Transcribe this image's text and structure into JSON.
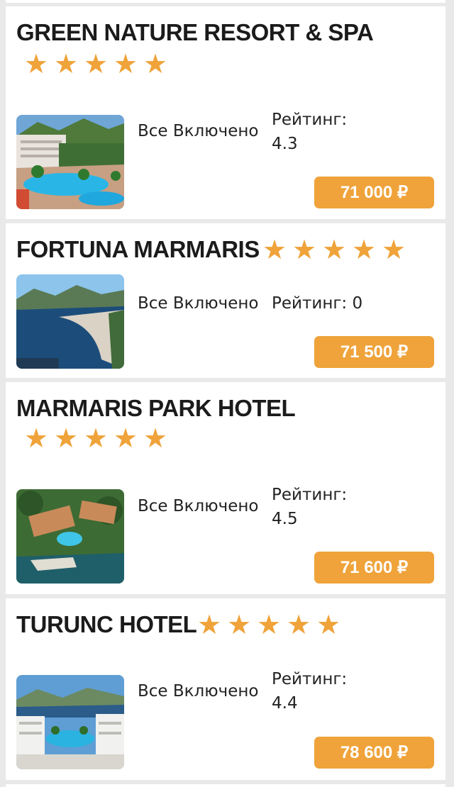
{
  "hotels": [
    {
      "name": "GREEN NATURE RESORT & SPA",
      "stars": 5,
      "board": "Все Включено",
      "rating_label": "Рейтинг:",
      "rating_value": "4.3",
      "price": "71 000 ₽"
    },
    {
      "name": "FORTUNA MARMARIS",
      "stars": 5,
      "board": "Все Включено",
      "rating_label": "Рейтинг: 0",
      "rating_value": "",
      "price": "71 500 ₽"
    },
    {
      "name": "MARMARIS PARK HOTEL",
      "stars": 5,
      "board": "Все Включено",
      "rating_label": "Рейтинг:",
      "rating_value": "4.5",
      "price": "71 600 ₽"
    },
    {
      "name": "TURUNC HOTEL",
      "stars": 5,
      "board": "Все Включено",
      "rating_label": "Рейтинг:",
      "rating_value": "4.4",
      "price": "78 600 ₽"
    }
  ],
  "colors": {
    "accent": "#efa33a",
    "background": "#e9e9e9",
    "card": "#ffffff"
  }
}
